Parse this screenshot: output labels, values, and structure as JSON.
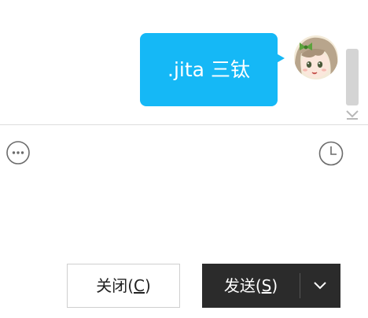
{
  "conversation": {
    "messages": [
      {
        "from": "self",
        "text": ".jita 三钛",
        "avatar": "anime-girl-avatar"
      }
    ]
  },
  "toolbar": {
    "more_icon": "ellipsis-circle-icon",
    "history_icon": "clock-icon"
  },
  "footer": {
    "close_label_main": "关闭(",
    "close_label_key": "C",
    "close_label_end": ")",
    "send_label_main": "发送(",
    "send_label_key": "S",
    "send_label_end": ")",
    "send_options_icon": "chevron-down-icon"
  },
  "colors": {
    "bubble": "#15b8f6",
    "send_button": "#2b2b2b",
    "divider": "#dddddd"
  }
}
